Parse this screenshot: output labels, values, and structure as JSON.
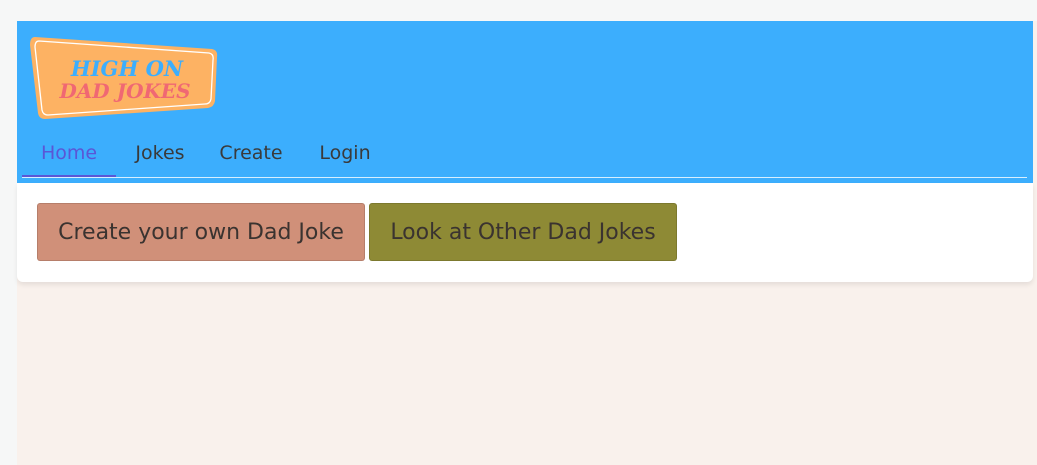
{
  "logo": {
    "line1": "HIGH ON",
    "line2": "DAD JOKES"
  },
  "nav": {
    "items": [
      {
        "label": "Home",
        "active": true
      },
      {
        "label": "Jokes",
        "active": false
      },
      {
        "label": "Create",
        "active": false
      },
      {
        "label": "Login",
        "active": false
      }
    ]
  },
  "actions": {
    "create_label": "Create your own Dad Joke",
    "look_label": "Look at Other Dad Jokes"
  },
  "colors": {
    "header": "#3caefd",
    "nav_active": "#5a56d6",
    "logo_bg": "#fdb263",
    "logo_line1": "#3caefd",
    "logo_line2": "#f06873",
    "create_button": "#d09079",
    "look_button": "#8e8a35",
    "page_bg": "#f9f1ec"
  }
}
